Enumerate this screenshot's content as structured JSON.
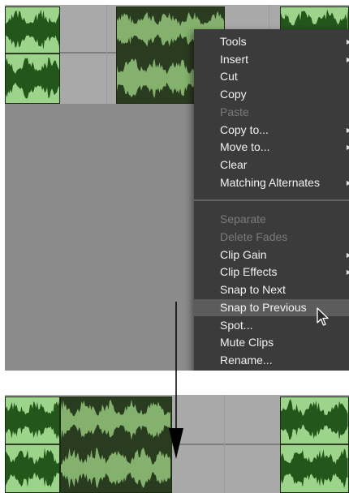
{
  "context_menu": {
    "items": [
      {
        "label": "Tools",
        "submenu": true,
        "enabled": true
      },
      {
        "label": "Insert",
        "submenu": true,
        "enabled": true
      },
      {
        "label": "Cut",
        "submenu": false,
        "enabled": true
      },
      {
        "label": "Copy",
        "submenu": false,
        "enabled": true
      },
      {
        "label": "Paste",
        "submenu": false,
        "enabled": false
      },
      {
        "label": "Copy to...",
        "submenu": true,
        "enabled": true
      },
      {
        "label": "Move to...",
        "submenu": true,
        "enabled": true
      },
      {
        "label": "Clear",
        "submenu": false,
        "enabled": true
      },
      {
        "label": "Matching Alternates",
        "submenu": true,
        "enabled": true
      },
      {
        "label": "Separate",
        "submenu": false,
        "enabled": false
      },
      {
        "label": "Delete Fades",
        "submenu": false,
        "enabled": false
      },
      {
        "label": "Clip Gain",
        "submenu": true,
        "enabled": true
      },
      {
        "label": "Clip Effects",
        "submenu": true,
        "enabled": true
      },
      {
        "label": "Snap to Next",
        "submenu": false,
        "enabled": true
      },
      {
        "label": "Snap to Previous",
        "submenu": false,
        "enabled": true,
        "highlighted": true
      },
      {
        "label": "Spot...",
        "submenu": false,
        "enabled": true
      },
      {
        "label": "Mute Clips",
        "submenu": false,
        "enabled": true
      },
      {
        "label": "Rename...",
        "submenu": false,
        "enabled": true
      }
    ]
  },
  "icons": {
    "submenu_arrow": "triangle-right-icon",
    "cursor": "mouse-pointer-icon",
    "indicator": "down-arrow-icon"
  },
  "colors": {
    "menu_background": "#3b3b3b",
    "menu_highlight": "#5c5c5c",
    "clip_light": "#9bd48a",
    "clip_dark": "#2a3c20",
    "waveform_dark": "#22561a",
    "waveform_light": "#84b26e"
  }
}
